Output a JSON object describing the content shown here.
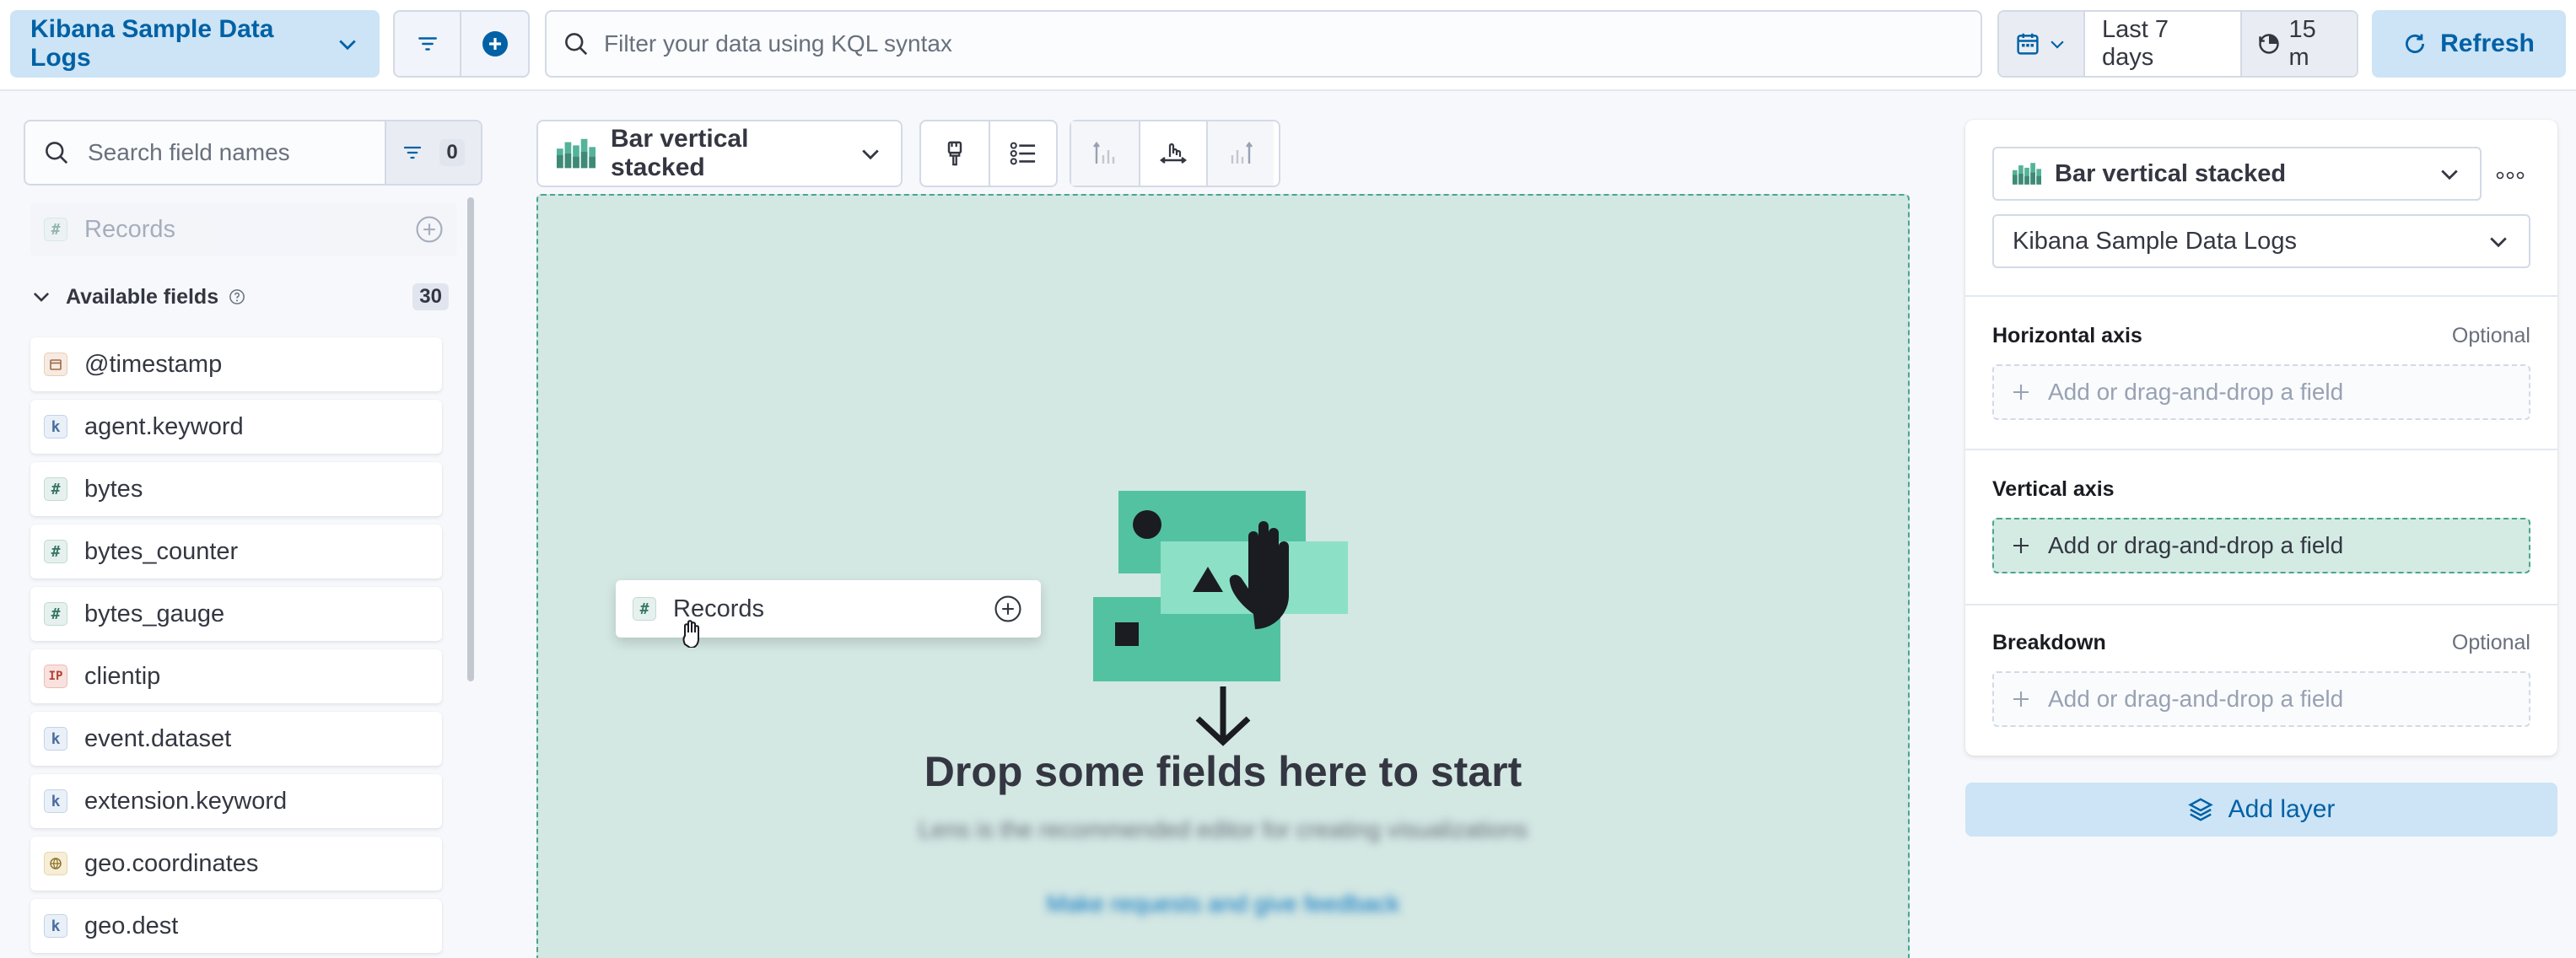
{
  "query_bar": {
    "data_view": "Kibana Sample Data Logs",
    "kql_placeholder": "Filter your data using KQL syntax",
    "time_range": "Last 7 days",
    "auto_refresh_interval": "15 m",
    "refresh_label": "Refresh"
  },
  "field_list": {
    "search_placeholder": "Search field names",
    "filter_count": "0",
    "records_label": "Records",
    "available_header": "Available fields",
    "available_count": "30",
    "fields": [
      {
        "name": "@timestamp",
        "type": "date"
      },
      {
        "name": "agent.keyword",
        "type": "keyword",
        "token": "k"
      },
      {
        "name": "bytes",
        "type": "number",
        "token": "#"
      },
      {
        "name": "bytes_counter",
        "type": "number",
        "token": "#"
      },
      {
        "name": "bytes_gauge",
        "type": "number",
        "token": "#"
      },
      {
        "name": "clientip",
        "type": "ip",
        "token": "IP"
      },
      {
        "name": "event.dataset",
        "type": "keyword",
        "token": "k"
      },
      {
        "name": "extension.keyword",
        "type": "keyword",
        "token": "k"
      },
      {
        "name": "geo.coordinates",
        "type": "geo"
      },
      {
        "name": "geo.dest",
        "type": "keyword",
        "token": "k"
      }
    ]
  },
  "workspace": {
    "chart_type": "Bar vertical stacked",
    "drag_item_label": "Records",
    "drag_item_token": "#",
    "drop_title": "Drop some fields here to start",
    "drop_subtitle": "Lens is the recommended editor for creating visualizations",
    "drop_link": "Make requests and give feedback"
  },
  "config_panel": {
    "chart_type": "Bar vertical stacked",
    "data_view": "Kibana Sample Data Logs",
    "horizontal_axis": {
      "title": "Horizontal axis",
      "optional": "Optional",
      "placeholder": "Add or drag-and-drop a field"
    },
    "vertical_axis": {
      "title": "Vertical axis",
      "placeholder": "Add or drag-and-drop a field"
    },
    "breakdown": {
      "title": "Breakdown",
      "optional": "Optional",
      "placeholder": "Add or drag-and-drop a field"
    },
    "add_layer_label": "Add layer"
  },
  "colors": {
    "primary": "#0061a6",
    "primary_light": "#cce4f5",
    "success": "#4aa58e",
    "dropzone_bg": "#d3e7e3"
  }
}
